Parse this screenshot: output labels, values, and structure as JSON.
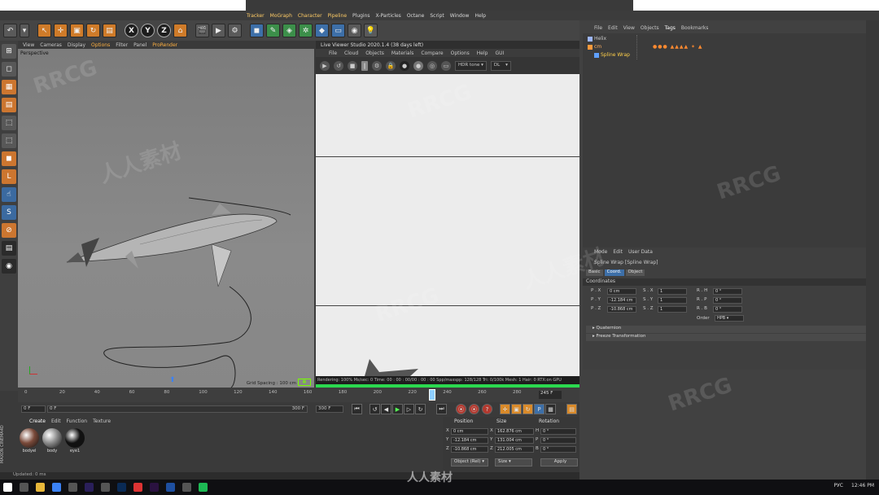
{
  "menubar": {
    "items": [
      "Tracker",
      "MoGraph",
      "Character",
      "Pipeline",
      "Plugins",
      "X-Particles",
      "Octane",
      "Script",
      "Window",
      "Help"
    ]
  },
  "viewport": {
    "menu": [
      "View",
      "Cameras",
      "Display",
      "Options",
      "Filter",
      "Panel",
      "ProRender"
    ],
    "label": "Perspective",
    "grid_spacing": "Grid Spacing : 100 cm"
  },
  "live_viewer": {
    "title": "Live Viewer Studio 2020.1.4 (38 days left)",
    "menu": [
      "File",
      "Cloud",
      "Objects",
      "Materials",
      "Compare",
      "Options",
      "Help",
      "GUI"
    ],
    "tone_select": "HDR tone",
    "dl_select": "DL",
    "status": "Rendering: 100%  Ms/sec: 0   Time: 00 : 00 : 00/00 : 00 : 00   Spp/maxspp: 128/128   Tri: 0/100k   Mesh: 1   Hair: 0   RTX:on   GPU"
  },
  "timeline": {
    "ticks": [
      "0",
      "20",
      "40",
      "60",
      "80",
      "100",
      "120",
      "140",
      "160",
      "180",
      "200",
      "220",
      "240",
      "260",
      "280"
    ],
    "end_frame": "245 F",
    "start_field": "0 F",
    "start2_field": "0 F",
    "end_field": "300 F",
    "end2_field": "300 F",
    "playhead_frame": 240,
    "playhead_max": 290
  },
  "materials": {
    "menu": [
      "Create",
      "Edit",
      "Function",
      "Texture"
    ],
    "items": [
      {
        "label": "bodyel",
        "color": "#7a4a3a"
      },
      {
        "label": "body",
        "color": "#8a8a8a"
      },
      {
        "label": "eye1",
        "color": "#111111"
      }
    ]
  },
  "coordinates": {
    "headers": [
      "Position",
      "Size",
      "Rotation"
    ],
    "rows": [
      {
        "axis": "X",
        "pos": "0 cm",
        "size": "162.876 cm",
        "rot_axis": "H",
        "rot": "0 °"
      },
      {
        "axis": "Y",
        "pos": "-12.184 cm",
        "size": "131.004 cm",
        "rot_axis": "P",
        "rot": "0 °"
      },
      {
        "axis": "Z",
        "pos": "-10.868 cm",
        "size": "212.005 cm",
        "rot_axis": "B",
        "rot": "0 °"
      }
    ],
    "mode_select": "Object (Rel)",
    "size_select": "Size",
    "apply": "Apply"
  },
  "status": "Updated: 0 ms",
  "maxon_label": "MAXON CINEMA4D",
  "object_manager": {
    "menu": [
      "File",
      "Edit",
      "View",
      "Objects",
      "Tags",
      "Bookmarks"
    ],
    "objects": [
      {
        "name": "Helix",
        "color": "#9db7ff"
      },
      {
        "name": "cm",
        "color": "#ff9a3c"
      },
      {
        "name": "Spline Wrap",
        "color": "#ffd04a"
      }
    ]
  },
  "attributes": {
    "menu": [
      "Mode",
      "Edit",
      "User Data"
    ],
    "title": "Spline Wrap [Spline Wrap]",
    "tabs": [
      "Basic",
      "Coord.",
      "Object"
    ],
    "active_tab": "Coord.",
    "section": "Coordinates",
    "rows": [
      {
        "p": "P . X",
        "pv": "0 cm",
        "s": "S . X",
        "sv": "1",
        "r": "R . H",
        "rv": "0 °"
      },
      {
        "p": "P . Y",
        "pv": "-12.184 cm",
        "s": "S . Y",
        "sv": "1",
        "r": "R . P",
        "rv": "0 °"
      },
      {
        "p": "P . Z",
        "pv": "-10.868 cm",
        "s": "S . Z",
        "sv": "1",
        "r": "R . B",
        "rv": "0 °"
      }
    ],
    "order_label": "Order",
    "order_value": "HPB",
    "groups": [
      "Quaternion",
      "Freeze Transformation"
    ]
  },
  "taskbar": {
    "lang": "РУС",
    "time": "12:46 PM"
  },
  "watermark": {
    "text": "RRCG",
    "cn": "人人素材"
  }
}
